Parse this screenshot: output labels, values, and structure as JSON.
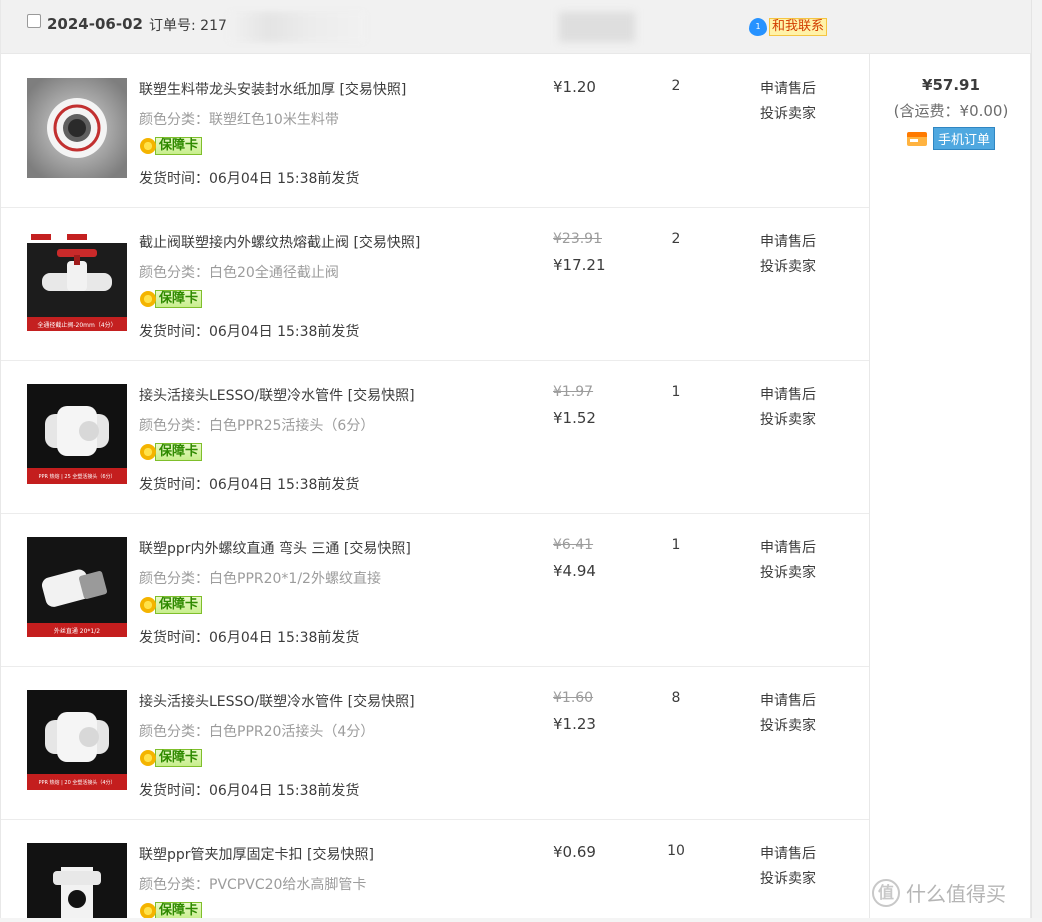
{
  "order": {
    "date": "2024-06-02",
    "order_no_label": "订单号: 217",
    "contact_label": "和我联系",
    "contact_badge": "1",
    "total": "¥57.91",
    "shipping_fee": "(含运费：¥0.00)",
    "mobile_label": "手机订单"
  },
  "items": [
    {
      "title": "联塑生料带龙头安装封水纸加厚 [交易快照]",
      "sku": "颜色分类：联塑红色10米生料带",
      "badge": "保障卡",
      "ship": "发货时间：06月04日 15:38前发货",
      "price_orig": "",
      "price": "¥1.20",
      "qty": "2",
      "action1": "申请售后",
      "action2": "投诉卖家"
    },
    {
      "title": "截止阀联塑接内外螺纹热熔截止阀 [交易快照]",
      "sku": "颜色分类：白色20全通径截止阀",
      "badge": "保障卡",
      "ship": "发货时间：06月04日 15:38前发货",
      "price_orig": "¥23.91",
      "price": "¥17.21",
      "qty": "2",
      "action1": "申请售后",
      "action2": "投诉卖家",
      "image_caption": "全通径截止阀-20mm（4分）"
    },
    {
      "title": "接头活接头LESSO/联塑冷水管件 [交易快照]",
      "sku": "颜色分类：白色PPR25活接头（6分）",
      "badge": "保障卡",
      "ship": "发货时间：06月04日 15:38前发货",
      "price_orig": "¥1.97",
      "price": "¥1.52",
      "qty": "1",
      "action1": "申请售后",
      "action2": "投诉卖家",
      "image_caption": "PPR 热熔 | 25 全塑活接头（6分）"
    },
    {
      "title": "联塑ppr内外螺纹直通 弯头 三通 [交易快照]",
      "sku": "颜色分类：白色PPR20*1/2外螺纹直接",
      "badge": "保障卡",
      "ship": "发货时间：06月04日 15:38前发货",
      "price_orig": "¥6.41",
      "price": "¥4.94",
      "qty": "1",
      "action1": "申请售后",
      "action2": "投诉卖家",
      "image_caption": "外丝直通 20*1/2"
    },
    {
      "title": "接头活接头LESSO/联塑冷水管件 [交易快照]",
      "sku": "颜色分类：白色PPR20活接头（4分）",
      "badge": "保障卡",
      "ship": "发货时间：06月04日 15:38前发货",
      "price_orig": "¥1.60",
      "price": "¥1.23",
      "qty": "8",
      "action1": "申请售后",
      "action2": "投诉卖家",
      "image_caption": "PPR 热熔 | 20 全塑活接头（4分）"
    },
    {
      "title": "联塑ppr管夹加厚固定卡扣 [交易快照]",
      "sku": "颜色分类：PVCPVC20给水高脚管卡",
      "badge": "保障卡",
      "ship": "",
      "price_orig": "",
      "price": "¥0.69",
      "qty": "10",
      "action1": "申请售后",
      "action2": "投诉卖家"
    }
  ],
  "watermark": {
    "icon": "值",
    "text": "什么值得买"
  }
}
